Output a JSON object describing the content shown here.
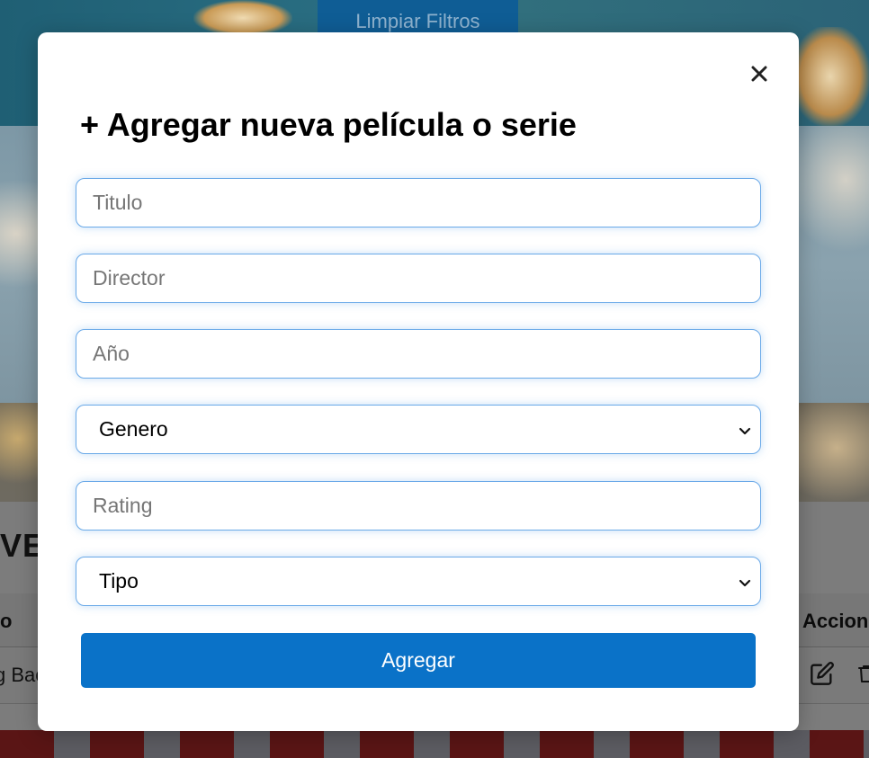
{
  "background": {
    "clear_filters_label": "Limpiar Filtros",
    "heading_fragment": "VE",
    "table_header_left_fragment": "o",
    "table_header_right_fragment": "Accion",
    "row_title_fragment": "g Bac",
    "row_actions": [
      "edit-icon",
      "trash-icon"
    ]
  },
  "modal": {
    "title": "+ Agregar nueva película o serie",
    "close_icon": "close-icon",
    "fields": {
      "titulo_placeholder": "Titulo",
      "director_placeholder": "Director",
      "anio_placeholder": "Año",
      "genero_selected": "Genero",
      "rating_placeholder": "Rating",
      "tipo_selected": "Tipo"
    },
    "submit_label": "Agregar"
  },
  "colors": {
    "primary_button": "#0a72c8",
    "input_border": "#6aa9e8"
  }
}
